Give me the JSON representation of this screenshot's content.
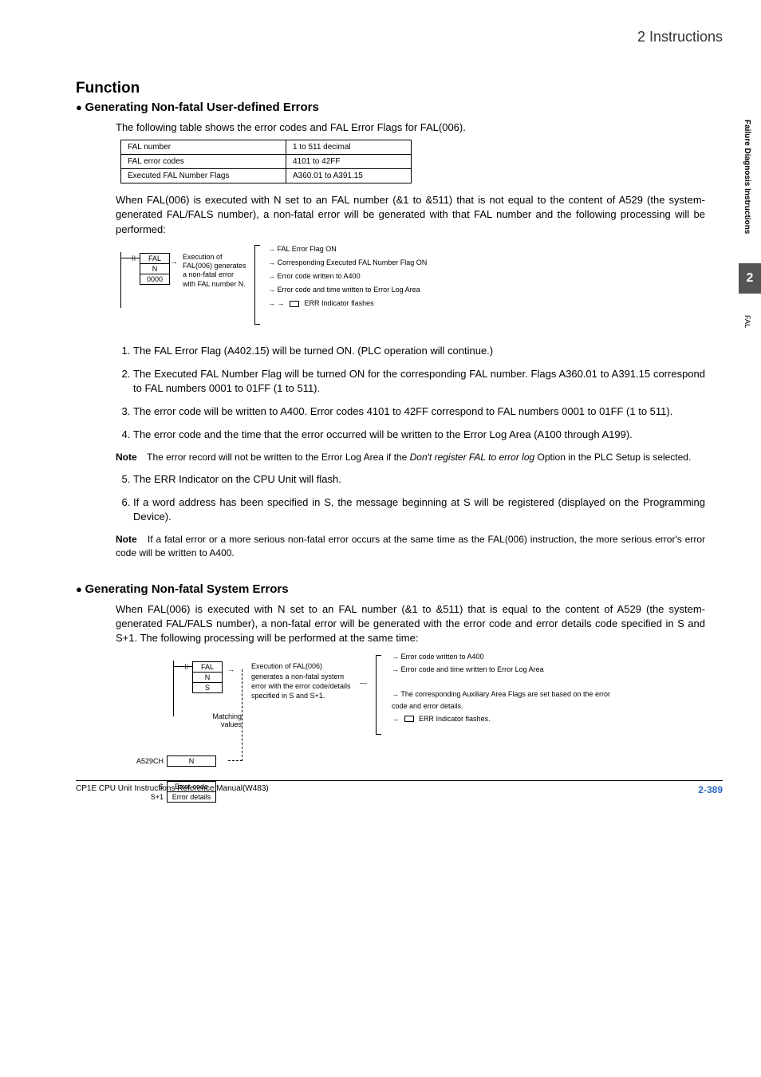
{
  "header": {
    "section": "2  Instructions"
  },
  "sidebar": {
    "vtext1": "Failure Diagnosis Instructions",
    "tab": "2",
    "vtext2": "FAL"
  },
  "h1": "Function",
  "h2a": "Generating Non-fatal User-defined Errors",
  "intro": "The following table shows the error codes and FAL Error Flags for FAL(006).",
  "table": {
    "r1c1": "FAL number",
    "r1c2": "1 to 511 decimal",
    "r2c1": "FAL error codes",
    "r2c2": "4101 to 42FF",
    "r3c1": "Executed FAL Number Flags",
    "r3c2": "A360.01 to A391.15"
  },
  "para1": "When FAL(006) is executed with N set to an FAL number (&1 to &511) that is not equal to the content of A529 (the system-generated FAL/FALS number), a non-fatal error will be generated with that FAL number and the following processing will be performed:",
  "diag1": {
    "lad": {
      "b1": "FAL",
      "b2": "N",
      "b3": "0000"
    },
    "exec": "Execution of FAL(006) generates a non-fatal error with FAL number N.",
    "i1": "FAL Error Flag ON",
    "i2": "Corresponding Executed FAL Number Flag ON",
    "i3": "Error code written to A400",
    "i4": "Error code and time written to Error Log Area",
    "i5": "ERR Indicator flashes"
  },
  "list": {
    "l1": "The FAL Error Flag (A402.15) will be turned ON. (PLC operation will continue.)",
    "l2": "The Executed FAL Number Flag will be turned ON for the corresponding FAL number. Flags A360.01 to A391.15 correspond to FAL numbers 0001 to 01FF (1 to 511).",
    "l3": "The error code will be written to A400. Error codes 4101 to 42FF correspond to FAL numbers 0001 to 01FF (1 to 511).",
    "l4": "The error code and the time that the error occurred will be written to the Error Log Area (A100 through A199).",
    "l5": "The ERR Indicator on the CPU Unit will flash.",
    "l6": "If a word address has been specified in S, the message beginning at S will be registered (displayed on the Programming Device)."
  },
  "note1_label": "Note",
  "note1": "The error record will not be written to the Error Log Area if the ",
  "note1_ital": "Don't register FAL to error log",
  "note1_end": " Option in the PLC Setup is selected.",
  "note2_label": "Note",
  "note2": "If a fatal error or a more serious non-fatal error occurs at the same time as the FAL(006) instruction, the more serious error's error code will be written to A400.",
  "h2b": "Generating Non-fatal System Errors",
  "para2": "When FAL(006) is executed with N set to an FAL number (&1 to &511) that is equal to the content of A529 (the system-generated FAL/FALS number), a non-fatal error will be generated with the error code and error details code specified in S and S+1. The following processing will be performed at the same time:",
  "diag2": {
    "lad": {
      "b1": "FAL",
      "b2": "N",
      "b3": "S"
    },
    "exec": "Execution of FAL(006) generates a non-fatal system error with the error code/details specified in S and S+1.",
    "match": "Matching values",
    "a529lbl": "A529CH",
    "a529val": "N",
    "slbl": "S",
    "sval": "Error code",
    "s1lbl": "S+1",
    "s1val": "Error details",
    "i1": "Error code written to A400",
    "i2": "Error code and time written to Error Log Area",
    "i3": "The corresponding Auxiliary Area Flags are set based on the error code and error details.",
    "i4": "ERR Indicator flashes."
  },
  "footer": {
    "doc": "CP1E CPU Unit Instructions Reference Manual(W483)",
    "page": "2-389"
  }
}
